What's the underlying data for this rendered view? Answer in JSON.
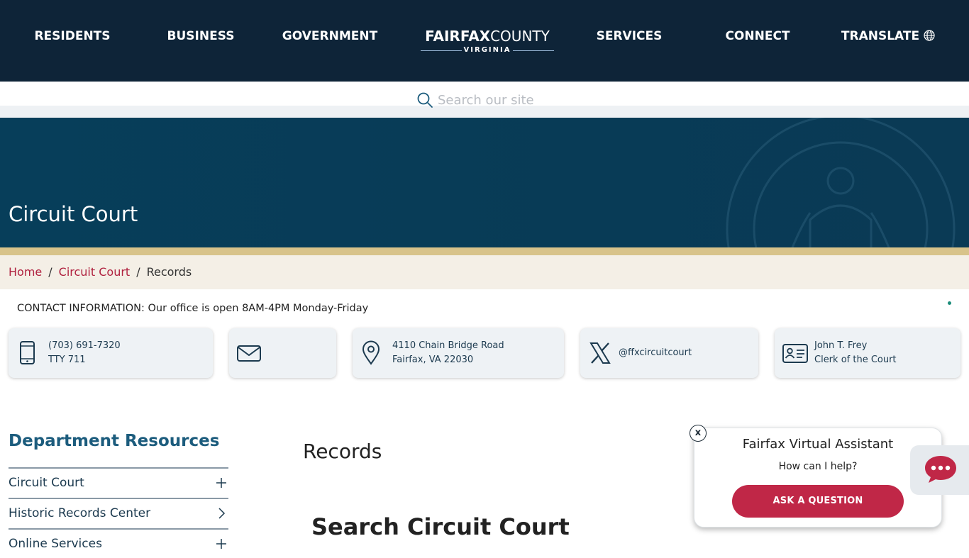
{
  "nav": {
    "residents": "RESIDENTS",
    "business": "BUSINESS",
    "government": "GOVERNMENT",
    "services": "SERVICES",
    "connect": "CONNECT",
    "translate": "TRANSLATE",
    "translate_icon": "globe-icon"
  },
  "logo": {
    "fairfax": "FAIRFAX",
    "county": "COUNTY",
    "state": "VIRGINIA"
  },
  "search": {
    "placeholder": "Search our site",
    "value": "",
    "icon": "search-icon"
  },
  "hero": {
    "title": "Circuit Court"
  },
  "breadcrumb": [
    {
      "label": "Home"
    },
    {
      "label": "Circuit Court"
    },
    {
      "label": "Records"
    }
  ],
  "contact": {
    "heading": "CONTACT INFORMATION: Our office is open 8AM-4PM Monday-Friday",
    "phone": {
      "line1": "(703) 691-7320",
      "line2": "TTY 711",
      "icon": "phone-icon"
    },
    "email": {
      "icon": "envelope-icon"
    },
    "address": {
      "line1": "4110 Chain Bridge Road",
      "line2": "Fairfax, VA 22030",
      "icon": "map-pin-icon"
    },
    "social": {
      "handle": "@ffxcircuitcourt",
      "icon": "x-logo-icon"
    },
    "clerk": {
      "line1": "John T. Frey",
      "line2": "Clerk of the Court",
      "icon": "id-card-icon"
    }
  },
  "sidebar": {
    "title": "Department Resources",
    "items": [
      {
        "label": "Circuit Court",
        "icon": "plus-icon"
      },
      {
        "label": "Historic Records Center",
        "icon": "chevron-right-icon"
      },
      {
        "label": "Online Services",
        "icon": "plus-icon"
      }
    ]
  },
  "main": {
    "title": "Records",
    "subtitle": "Search Circuit Court"
  },
  "assistant": {
    "close": "x",
    "title": "Fairfax Virtual Assistant",
    "subtitle": "How can I help?",
    "button": "ASK A QUESTION",
    "launcher_icon": "chat-bubble-icon"
  },
  "colors": {
    "nav_bg": "#0e2438",
    "hero_bg": "#073e5a",
    "gold_bar": "#d8c38a",
    "crumb_bg": "#f4efe6",
    "link_red": "#b0213f",
    "accent_red": "#c02747",
    "sidebar_title": "#1c5c7d"
  }
}
